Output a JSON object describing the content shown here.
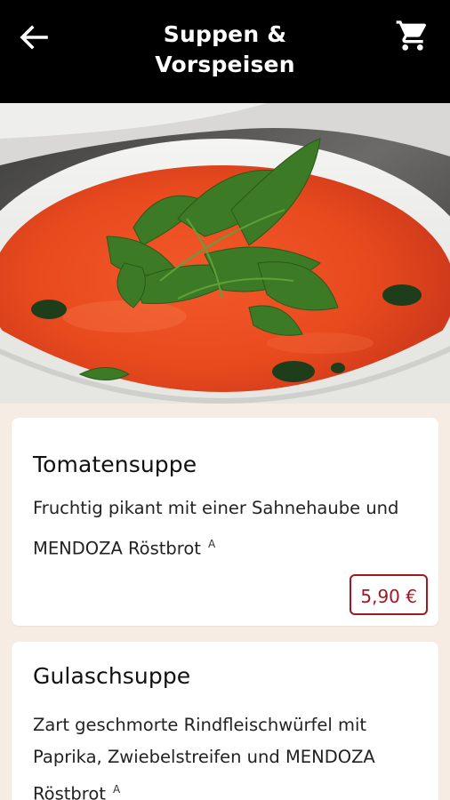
{
  "header": {
    "title_line1": "Suppen &",
    "title_line2": "Vorspeisen",
    "back_icon": "arrow-left-icon",
    "cart_icon": "shopping-cart-icon"
  },
  "hero": {
    "image": "tomato-soup-with-arugula"
  },
  "menu": {
    "items": [
      {
        "name": "Tomatensuppe",
        "description": "Fruchtig pikant mit einer Sahnehaube und MENDOZA Röstbrot",
        "allergen": "A",
        "price": "5,90 €"
      },
      {
        "name": "Gulaschsuppe",
        "description": "Zart geschmorte Rindfleischwürfel mit Paprika, Zwiebelstreifen und MENDOZA Röstbrot",
        "allergen": "A"
      }
    ]
  },
  "colors": {
    "header_bg": "#000000",
    "page_bg": "#f7ece3",
    "accent": "#a01821"
  }
}
